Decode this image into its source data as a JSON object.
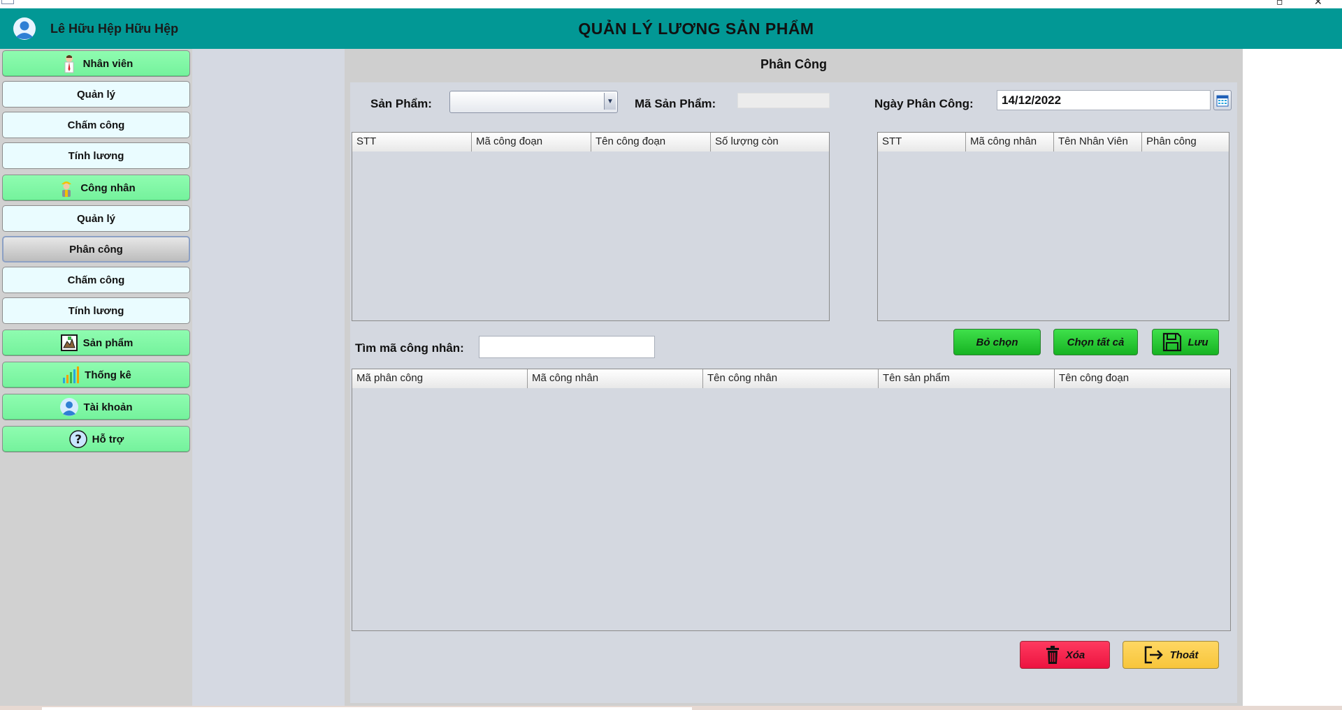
{
  "header": {
    "user_name": "Lê Hữu Hệp Hữu Hệp",
    "title": "QUẢN LÝ LƯƠNG SẢN PHẨM",
    "color": "#029895"
  },
  "sidebar": {
    "items": [
      {
        "label": "Nhân viên",
        "kind": "section",
        "icon": "employee-icon"
      },
      {
        "label": "Quản lý",
        "kind": "sub"
      },
      {
        "label": "Chấm công",
        "kind": "sub"
      },
      {
        "label": "Tính lương",
        "kind": "sub"
      },
      {
        "label": "Công nhân",
        "kind": "section",
        "icon": "worker-icon"
      },
      {
        "label": "Quản lý",
        "kind": "sub"
      },
      {
        "label": "Phân công",
        "kind": "sub",
        "active": true
      },
      {
        "label": "Chấm công",
        "kind": "sub"
      },
      {
        "label": "Tính lương",
        "kind": "sub"
      },
      {
        "label": "Sản phẩm",
        "kind": "section",
        "icon": "product-icon"
      },
      {
        "label": "Thống kê",
        "kind": "section",
        "icon": "statistics-icon"
      },
      {
        "label": "Tài khoản",
        "kind": "section",
        "icon": "account-icon"
      },
      {
        "label": "Hỗ trợ",
        "kind": "section",
        "icon": "help-icon"
      }
    ]
  },
  "main": {
    "title": "Phân Công",
    "product_label": "Sản Phẩm:",
    "product_value": "",
    "product_code_label": "Mã Sản Phẩm:",
    "product_code_value": "",
    "date_label": "Ngày Phân Công:",
    "date_value": "14/12/2022",
    "stage_table": {
      "columns": [
        "STT",
        "Mã công đoạn",
        "Tên công đoạn",
        "Số lượng còn"
      ],
      "rows": []
    },
    "worker_table": {
      "columns": [
        "STT",
        "Mã công nhân",
        "Tên Nhân Viên",
        "Phân công"
      ],
      "rows": []
    },
    "search_label": "Tìm mã công nhân:",
    "search_value": "",
    "buttons": {
      "deselect": "Bỏ chọn",
      "select_all": "Chọn tất cả",
      "save": "Lưu",
      "delete": "Xóa",
      "exit": "Thoát"
    },
    "assignment_table": {
      "columns": [
        "Mã phân công",
        "Mã công nhân",
        "Tên công nhân",
        "Tên sản phẩm",
        "Tên công đoạn"
      ],
      "rows": []
    }
  },
  "colors": {
    "section_button": "#7ef5a3",
    "green_button": "#16b322",
    "red_button": "#ec1340",
    "yellow_button": "#f7c53a"
  }
}
